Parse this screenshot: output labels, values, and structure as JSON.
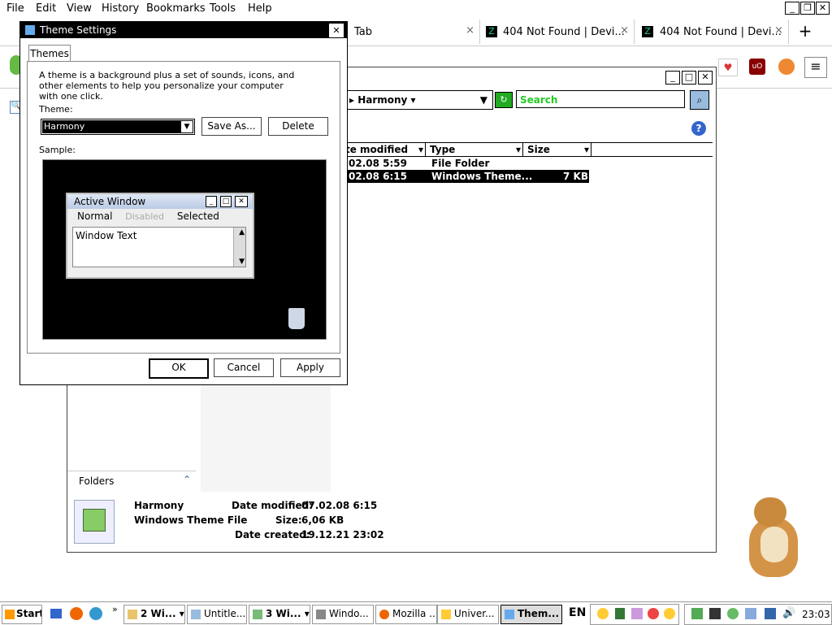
{
  "menubar": {
    "items": [
      "File",
      "Edit",
      "View",
      "History",
      "Bookmarks",
      "Tools",
      "Help"
    ]
  },
  "browser_tabs": [
    {
      "label": "Tab",
      "close": "×"
    },
    {
      "label": "404 Not Found | Devi...",
      "close": "×"
    },
    {
      "label": "404 Not Found | Devi...",
      "close": "×"
    }
  ],
  "new_tab": "+",
  "explorer": {
    "address_crumb": "Harmony",
    "search_placeholder": "Search",
    "columns": [
      "te modified",
      "Type",
      "Size"
    ],
    "rows": [
      {
        "date": "02.08 5:59",
        "type": "File Folder",
        "size": ""
      },
      {
        "date": "02.08 6:15",
        "type": "Windows Theme...",
        "size": "7 KB"
      }
    ],
    "folders_label": "Folders",
    "details": {
      "name": "Harmony",
      "kind": "Windows Theme File",
      "modified_label": "Date modified:",
      "modified_value": "07.02.08 6:15",
      "size_label": "Size:",
      "size_value": "6,06 KB",
      "created_label": "Date created:",
      "created_value": "19.12.21 23:02"
    }
  },
  "dialog": {
    "title": "Theme Settings",
    "tab": "Themes",
    "description": "A theme is a background plus a set of sounds, icons, and other elements to help you personalize your computer with one click.",
    "theme_label": "Theme:",
    "theme_value": "Harmony",
    "save_as": "Save As...",
    "delete": "Delete",
    "sample_label": "Sample:",
    "sample": {
      "window_title": "Active Window",
      "menu_normal": "Normal",
      "menu_disabled": "Disabled",
      "menu_selected": "Selected",
      "window_text": "Window Text"
    },
    "ok": "OK",
    "cancel": "Cancel",
    "apply": "Apply"
  },
  "taskbar": {
    "start": "Start",
    "items": [
      "2 Wi...",
      "Untitle...",
      "3 Wi...",
      "Windo...",
      "Mozilla ...",
      "Univer...",
      "Them..."
    ],
    "lang": "EN",
    "clock": "23:03"
  }
}
